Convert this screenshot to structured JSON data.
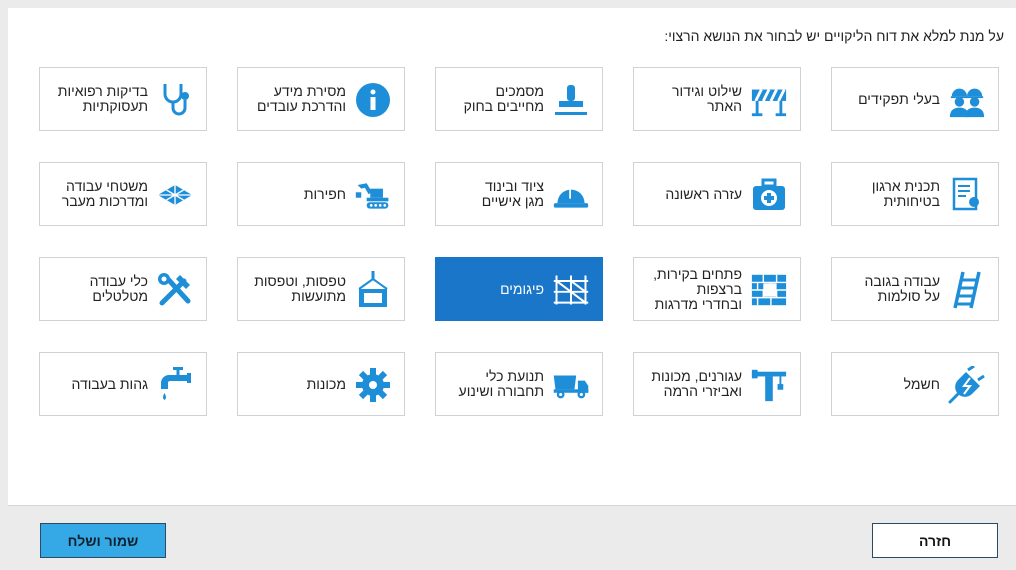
{
  "instruction": "על מנת למלא את דוח הליקויים יש לבחור את הנושא הרצוי:",
  "colors": {
    "accent": "#1976c9",
    "icon": "#1f8ed8",
    "save_button": "#35a9e6"
  },
  "tiles": [
    {
      "label": "בעלי תפקידים",
      "icon": "workers-icon"
    },
    {
      "label": "שילוט וגידור\nהאתר",
      "icon": "barrier-icon"
    },
    {
      "label": "מסמכים\nמחייבים בחוק",
      "icon": "stamp-icon"
    },
    {
      "label": "מסירת מידע\nוהדרכת עובדים",
      "icon": "info-icon"
    },
    {
      "label": "בדיקות רפואיות\nתעסוקתיות",
      "icon": "stethoscope-icon"
    },
    {
      "label": "תכנית ארגון\nבטיחותית",
      "icon": "certificate-icon"
    },
    {
      "label": "עזרה ראשונה",
      "icon": "first-aid-kit-icon"
    },
    {
      "label": "ציוד ובינוד\nמגן אישיים",
      "icon": "hard-hat-icon"
    },
    {
      "label": "חפירות",
      "icon": "excavator-icon"
    },
    {
      "label": "משטחי עבודה\nומדרכות מעבר",
      "icon": "walkway-icon"
    },
    {
      "label": "עבודה בגובה\nעל סולמות",
      "icon": "ladder-icon"
    },
    {
      "label": "פתחים בקירות,\nברצפות\nובחדרי מדרגות",
      "icon": "brick-wall-icon"
    },
    {
      "label": "פיגומים",
      "icon": "scaffold-icon",
      "selected": true
    },
    {
      "label": "טפסות, וטפסות\nמתועשות",
      "icon": "formwork-icon"
    },
    {
      "label": "כלי עבודה\nמטלטלים",
      "icon": "tools-icon"
    },
    {
      "label": "חשמל",
      "icon": "electric-plug-icon"
    },
    {
      "label": "עגורנים, מכונות\nואביזרי הרמה",
      "icon": "crane-icon"
    },
    {
      "label": "תנועת כלי\nתחבורה ושינוע",
      "icon": "dump-truck-icon"
    },
    {
      "label": "מכונות",
      "icon": "gear-icon"
    },
    {
      "label": "גהות בעבודה",
      "icon": "faucet-icon"
    }
  ],
  "buttons": {
    "back": "חזרה",
    "save": "שמור ושלח"
  }
}
